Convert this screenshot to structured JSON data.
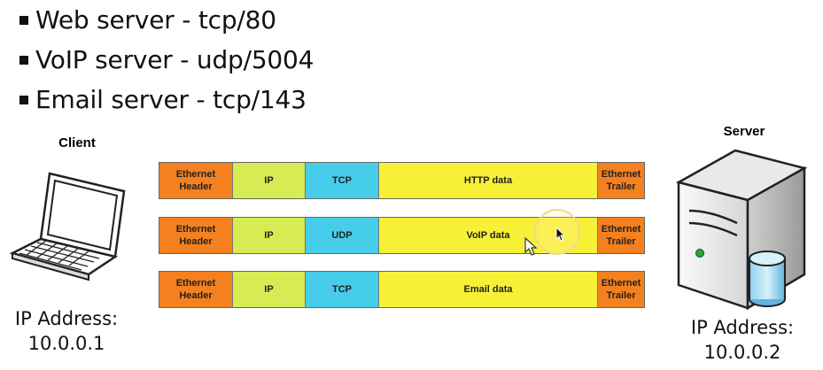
{
  "bullets": [
    {
      "text": "Web server - tcp/80"
    },
    {
      "text": "VoIP server - udp/5004"
    },
    {
      "text": "Email server - tcp/143"
    }
  ],
  "client": {
    "title": "Client",
    "ip_label": "IP Address:",
    "ip_value": "10.0.0.1",
    "icon": "laptop-icon"
  },
  "server": {
    "title": "Server",
    "ip_label": "IP Address:",
    "ip_value": "10.0.0.2",
    "icon": "server-icon"
  },
  "frames": [
    {
      "eth_header": "Ethernet Header",
      "ip": "IP",
      "transport": "TCP",
      "data": "HTTP data",
      "eth_trailer": "Ethernet Trailer"
    },
    {
      "eth_header": "Ethernet Header",
      "ip": "IP",
      "transport": "UDP",
      "data": "VoIP data",
      "eth_trailer": "Ethernet Trailer"
    },
    {
      "eth_header": "Ethernet Header",
      "ip": "IP",
      "transport": "TCP",
      "data": "Email data",
      "eth_trailer": "Ethernet Trailer"
    }
  ],
  "colors": {
    "ethernet": "#f5801f",
    "ip": "#d7ec52",
    "transport": "#46cde9",
    "data": "#f8f037"
  }
}
